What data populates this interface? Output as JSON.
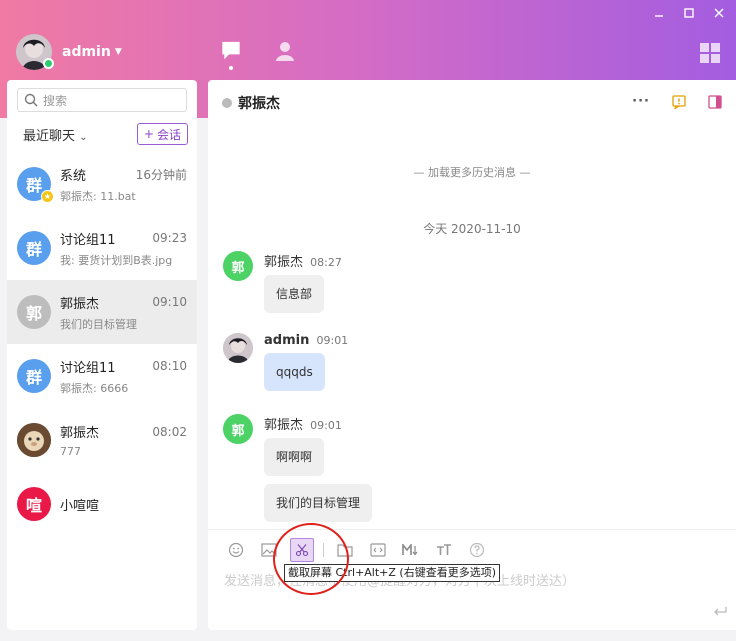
{
  "app": {
    "user": {
      "name": "admin"
    },
    "search": {
      "placeholder": "搜索"
    },
    "filter": {
      "label": "最近聊天",
      "new_chat_label": "会话"
    }
  },
  "chats": [
    {
      "name": "系统",
      "preview": "郭振杰: 11.bat",
      "time": "16分钟前",
      "avatar_text": "群",
      "avatar_color": "#5a9fee",
      "badge": "star"
    },
    {
      "name": "讨论组11",
      "preview": "我: 要货计划到B表.jpg",
      "time": "09:23",
      "avatar_text": "群",
      "avatar_color": "#5a9fee"
    },
    {
      "name": "郭振杰",
      "preview": "我们的目标管理",
      "time": "09:10",
      "avatar_text": "郭",
      "avatar_color": "#bdbdbd",
      "active": true
    },
    {
      "name": "讨论组11",
      "preview": "郭振杰: 6666",
      "time": "08:10",
      "avatar_text": "群",
      "avatar_color": "#5a9fee"
    },
    {
      "name": "郭振杰",
      "preview": "777",
      "time": "08:02",
      "avatar_text": "",
      "avatar_color": "#8a5a3a"
    },
    {
      "name": "小喧喧",
      "preview": "",
      "time": "",
      "avatar_text": "喧",
      "avatar_color": "#ea1846"
    }
  ],
  "conversation": {
    "title": "郭振杰",
    "load_more": "— 加载更多历史消息 —",
    "date_divider": "今天 2020-11-10",
    "messages": [
      {
        "sender": "郭振杰",
        "time": "08:27",
        "avatar_text": "郭",
        "avatar_color": "#4cd265",
        "bubbles": [
          "信息部"
        ]
      },
      {
        "sender": "admin",
        "time": "09:01",
        "avatar_text": "",
        "bubbles": [
          "qqqds"
        ]
      },
      {
        "sender": "郭振杰",
        "time": "09:01",
        "avatar_text": "郭",
        "avatar_color": "#4cd265",
        "bubbles": [
          "啊啊啊",
          "我们的目标管理"
        ]
      }
    ]
  },
  "composer": {
    "placeholder": "发送消息，在消息中使用@提醒对方，对方下次上线时送达）",
    "tooltip": "截取屏幕 Ctrl+Alt+Z (右键查看更多选项)"
  },
  "colors": {
    "accent": "#8a44c9",
    "header_gradient": [
      "#f07aa3",
      "#a35de0"
    ],
    "online": "#2ecc71",
    "highlight_circle": "#e0201b"
  }
}
